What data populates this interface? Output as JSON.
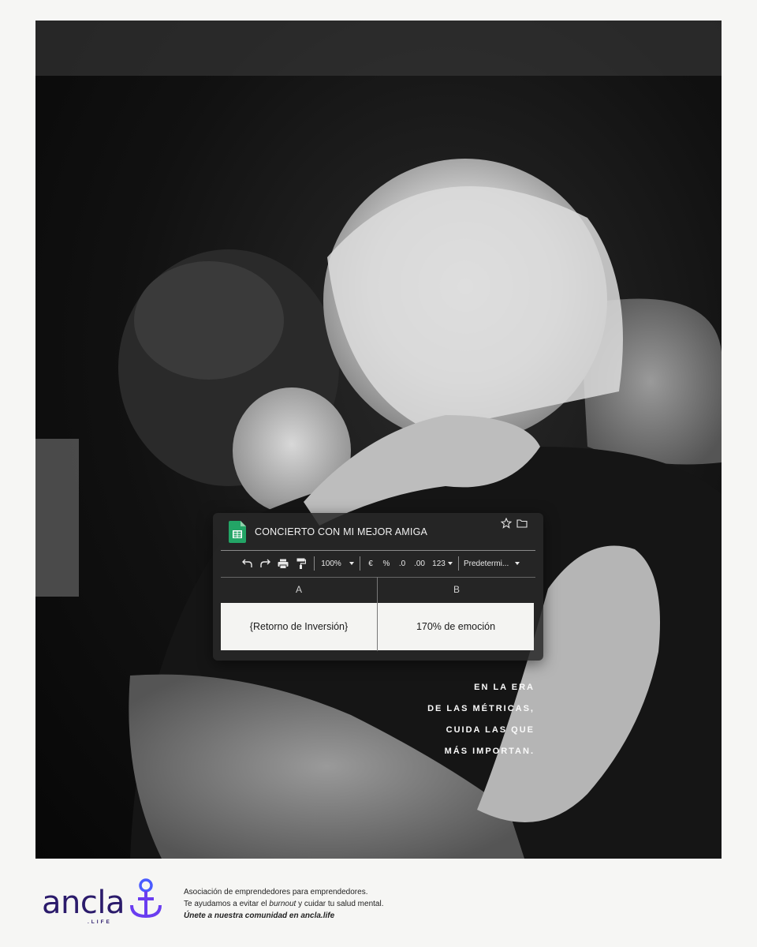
{
  "sheet": {
    "title": "CONCIERTO CON MI MEJOR AMIGA",
    "toolbar": {
      "zoom": "100%",
      "currency": "€",
      "percent": "%",
      "dec_decrease": ".0",
      "dec_increase": ".00",
      "format_more": "123",
      "font": "Predetermi..."
    },
    "columns": [
      "A",
      "B"
    ],
    "cells": [
      "{Retorno de Inversión}",
      "170% de emoción"
    ]
  },
  "tagline": [
    "EN LA ERA",
    "DE LAS MÉTRICAS,",
    "CUIDA LAS QUE",
    "MÁS IMPORTAN."
  ],
  "footer": {
    "logo_word": "ancla",
    "logo_sub": ".LIFE",
    "line1": "Asociación de emprendedores para emprendedores.",
    "line2_a": "Te ayudamos a evitar el ",
    "line2_b": "burnout",
    "line2_c": " y cuidar tu salud mental.",
    "line3": "Únete a nuestra comunidad en ancla.life"
  },
  "colors": {
    "brand": "#2b1b6b",
    "accent": "#4a5bff",
    "sheets_green": "#23a566"
  }
}
